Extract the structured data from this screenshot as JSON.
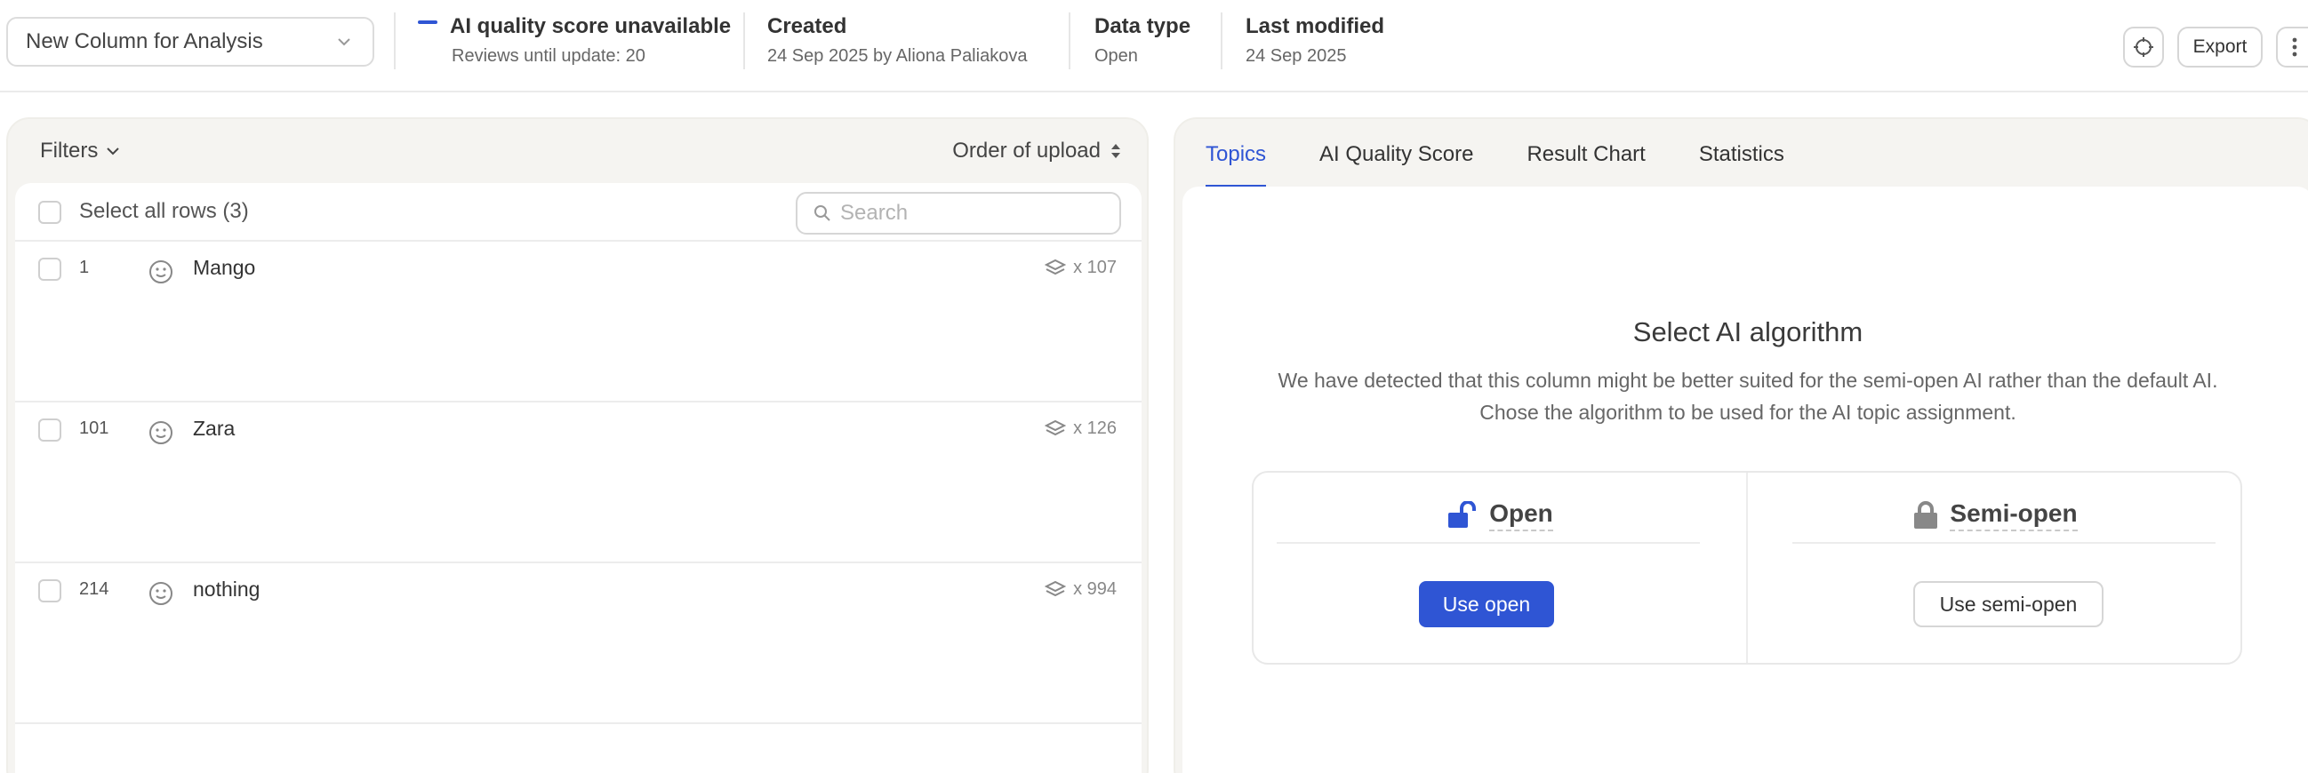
{
  "header": {
    "column_select": {
      "value": "New Column for Analysis",
      "icon": "chevron-down-icon"
    },
    "quality": {
      "title": "AI quality score unavailable",
      "subtitle": "Reviews until update: 20",
      "indicator_color": "#2f55d4"
    },
    "created": {
      "title": "Created",
      "value": "24 Sep 2025 by Aliona Paliakova"
    },
    "data_type": {
      "title": "Data type",
      "value": "Open"
    },
    "last_modified": {
      "title": "Last modified",
      "value": "24 Sep 2025"
    },
    "actions": {
      "settings_icon": "crosshair-icon",
      "export_label": "Export",
      "more_icon": "more-vertical-icon"
    }
  },
  "left_panel": {
    "filters_label": "Filters",
    "order_label": "Order of upload",
    "select_all_label": "Select all rows (3)",
    "search_placeholder": "Search",
    "rows": [
      {
        "number": "1",
        "text": "Mango",
        "count": "x 107"
      },
      {
        "number": "101",
        "text": "Zara",
        "count": "x 126"
      },
      {
        "number": "214",
        "text": "nothing",
        "count": "x 994"
      }
    ]
  },
  "right_panel": {
    "tabs": [
      {
        "label": "Topics",
        "active": true
      },
      {
        "label": "AI Quality Score",
        "active": false
      },
      {
        "label": "Result Chart",
        "active": false
      },
      {
        "label": "Statistics",
        "active": false
      }
    ],
    "algorithm": {
      "title": "Select AI algorithm",
      "description": "We have detected that this column might be better suited for the semi-open AI rather than the default AI. Chose the algorithm to be used for the AI topic assignment.",
      "open": {
        "label": "Open",
        "button": "Use open",
        "icon": "unlock-icon"
      },
      "semi_open": {
        "label": "Semi-open",
        "button": "Use semi-open",
        "icon": "lock-icon"
      }
    }
  },
  "colors": {
    "accent": "#2f55d4",
    "panel_bg": "#f5f4f1",
    "border": "#e6e6e6"
  }
}
